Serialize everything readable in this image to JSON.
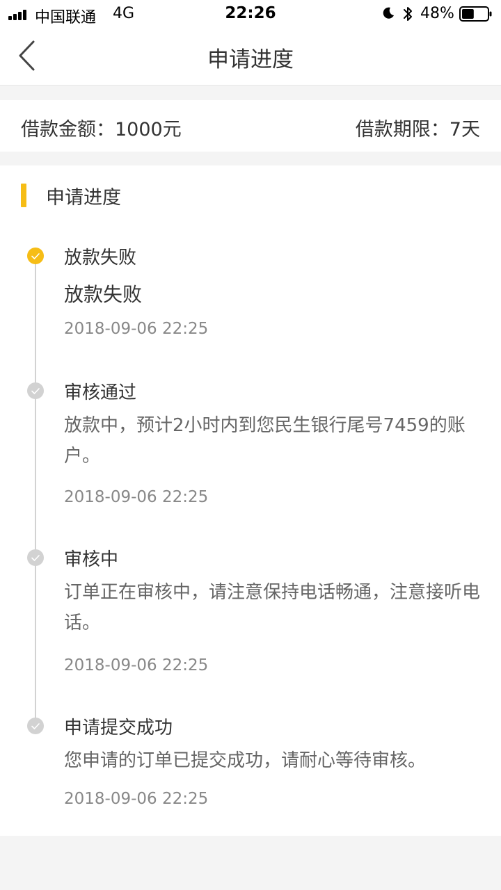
{
  "status_bar": {
    "carrier": "中国联通",
    "network": "4G",
    "time": "22:26",
    "battery_percent": "48%",
    "battery_level": 0.48
  },
  "nav": {
    "title": "申请进度"
  },
  "loan": {
    "amount_label": "借款金额：1000元",
    "term_label": "借款期限：7天"
  },
  "progress": {
    "section_title": "申请进度",
    "accent_color": "#f6bd16",
    "inactive_color": "#d2d2d2",
    "steps": [
      {
        "title": "放款失败",
        "desc": "放款失败",
        "time": "2018-09-06 22:25",
        "active": true
      },
      {
        "title": "审核通过",
        "desc": "放款中，预计2小时内到您民生银行尾号7459的账户。",
        "time": "2018-09-06 22:25",
        "active": false
      },
      {
        "title": "审核中",
        "desc": "订单正在审核中，请注意保持电话畅通，注意接听电话。",
        "time": "2018-09-06 22:25",
        "active": false
      },
      {
        "title": "申请提交成功",
        "desc": "您申请的订单已提交成功，请耐心等待审核。",
        "time": "2018-09-06 22:25",
        "active": false
      }
    ]
  }
}
